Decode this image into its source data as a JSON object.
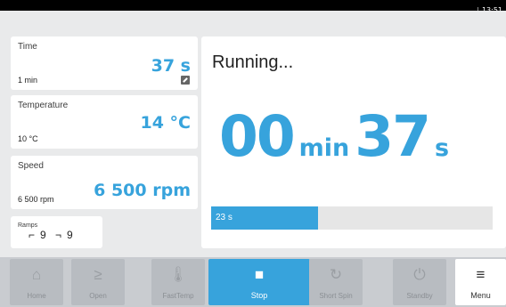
{
  "status_bar": {
    "clock": "13:51"
  },
  "time": {
    "label": "Time",
    "value": "37 s",
    "setpoint": "1 min"
  },
  "temperature": {
    "label": "Temperature",
    "value": "14 °C",
    "setpoint": "10 °C"
  },
  "speed": {
    "label": "Speed",
    "value": "6 500 rpm",
    "setpoint": "6 500 rpm"
  },
  "ramps": {
    "label": "Ramps",
    "accel": "9",
    "decel": "9"
  },
  "run": {
    "status": "Running...",
    "minutes": "00",
    "minutes_unit": "min",
    "seconds": "37",
    "seconds_unit": "s",
    "progress_label": "23 s",
    "progress_fraction": 0.38
  },
  "toolbar": [
    {
      "id": "home",
      "label": "Home",
      "icon": "home-icon",
      "glyph": "⌂",
      "enabled": false
    },
    {
      "id": "open",
      "label": "Open",
      "icon": "lid-open-icon",
      "glyph": "≥",
      "enabled": false
    },
    {
      "id": "fasttemp",
      "label": "FastTemp",
      "icon": "thermometer-icon",
      "glyph": "🌡",
      "enabled": false
    },
    {
      "id": "stop",
      "label": "Stop",
      "icon": "stop-icon",
      "glyph": "■",
      "enabled": true
    },
    {
      "id": "shortspin",
      "label": "Short Spin",
      "icon": "short-spin-icon",
      "glyph": "↻",
      "enabled": false
    },
    {
      "id": "standby",
      "label": "Standby",
      "icon": "power-icon",
      "glyph": "⏻",
      "enabled": false
    },
    {
      "id": "menu",
      "label": "Menu",
      "icon": "menu-icon",
      "glyph": "≡",
      "enabled": true
    }
  ],
  "colors": {
    "accent": "#37a3dc",
    "status_bar": "#000000",
    "background": "#e9eaeb"
  }
}
